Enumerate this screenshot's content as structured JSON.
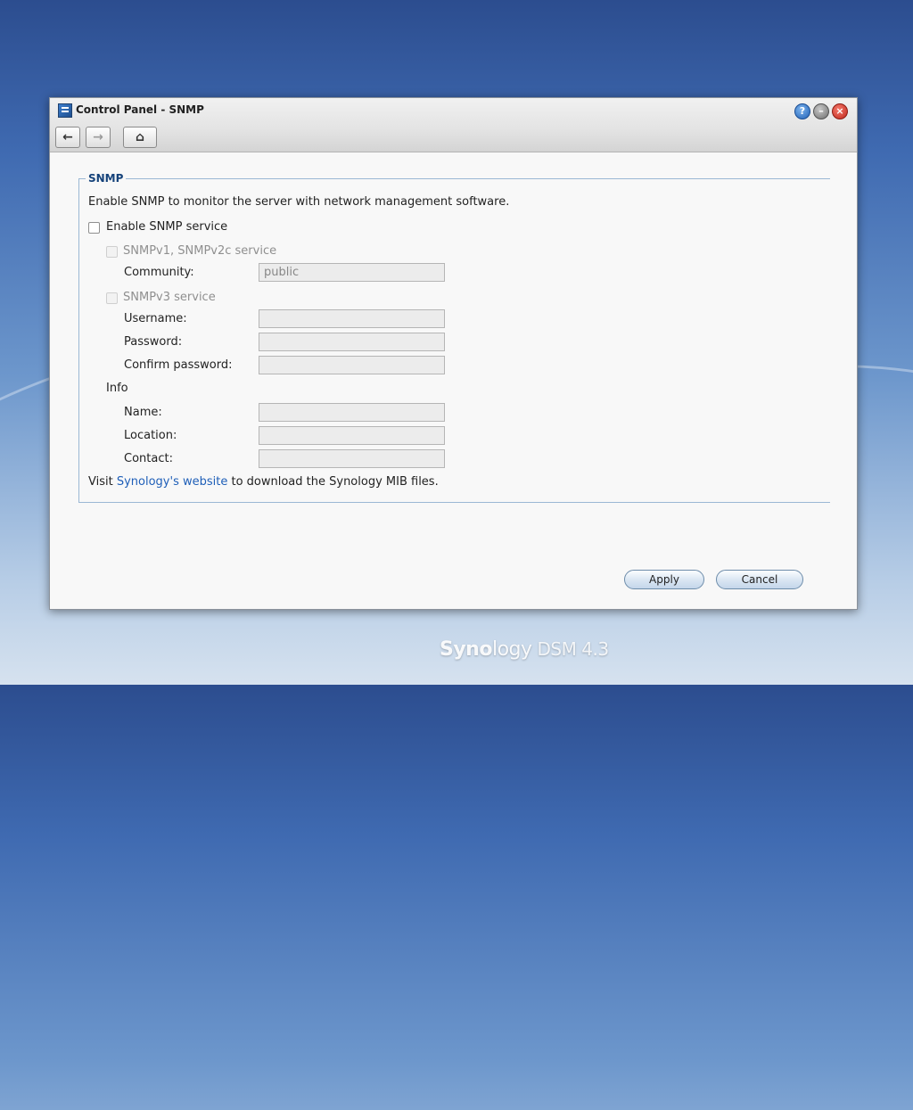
{
  "window": {
    "title": "Control Panel - SNMP",
    "controls": {
      "help": "?",
      "minimize": "–",
      "close": "×"
    },
    "nav": {
      "back": "←",
      "forward": "→",
      "home": "⌂"
    }
  },
  "snmp": {
    "legend": "SNMP",
    "description": "Enable SNMP to monitor the server with network management software.",
    "enable_label": "Enable SNMP service",
    "v1v2c_label": "SNMPv1, SNMPv2c service",
    "community_label": "Community:",
    "community_value": "public",
    "v3_label": "SNMPv3 service",
    "username_label": "Username:",
    "password_label": "Password:",
    "confirm_password_label": "Confirm password:",
    "info_label": "Info",
    "name_label": "Name:",
    "location_label": "Location:",
    "contact_label": "Contact:",
    "footer_prefix": "Visit ",
    "footer_link": "Synology's website",
    "footer_suffix": " to download the Synology MIB files."
  },
  "buttons": {
    "apply": "Apply",
    "cancel": "Cancel"
  },
  "branding": {
    "name_bold": "Syno",
    "name_rest": "logy",
    "product": "DSM 4.3"
  }
}
